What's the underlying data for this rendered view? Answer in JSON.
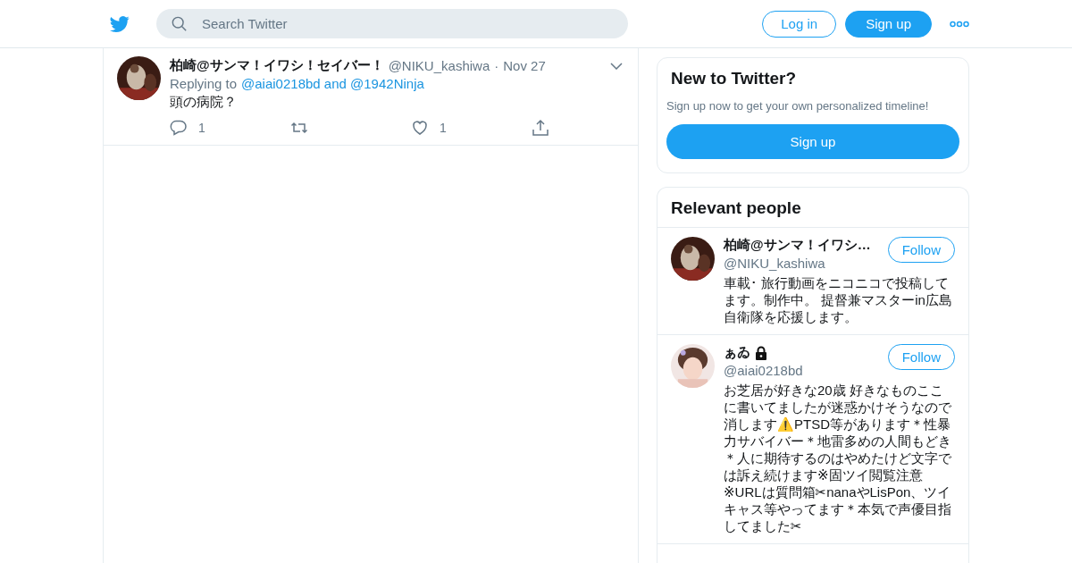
{
  "header": {
    "search": {
      "placeholder": "Search Twitter"
    },
    "buttons": [
      {
        "label": "Log in",
        "kind": "outline"
      },
      {
        "label": "Sign up",
        "kind": "filled"
      }
    ]
  },
  "tweet": {
    "name": "柏崎@サンマ！イワシ！セイバー！",
    "handle": "@NIKU_kashiwa",
    "separator": "·",
    "date": "Nov 27",
    "replying_label": "Replying to",
    "replying_to": "@aiai0218bd and @1942Ninja",
    "text": "頭の病院？",
    "actions": [
      {
        "kind": "reply",
        "count": "1"
      },
      {
        "kind": "retweet"
      },
      {
        "kind": "like",
        "count": "1"
      },
      {
        "kind": "share"
      }
    ]
  },
  "signup_card": {
    "title": "New to Twitter?",
    "subtitle": "Sign up now to get your own personalized timeline!",
    "button": "Sign up"
  },
  "relevant_people": {
    "title": "Relevant people",
    "people": [
      {
        "name": "柏崎@サンマ！イワシ…",
        "protected": false,
        "handle": "@NIKU_kashiwa",
        "follow": "Follow",
        "bio": "車載･ 旅行動画をニコニコで投稿してます。制作中。 提督兼マスターin広島自衛隊を応援します。"
      },
      {
        "name": "ぁゐ",
        "protected": true,
        "handle": "@aiai0218bd",
        "follow": "Follow",
        "bio": "お芝居が好きな20歳 好きなものここに書いてましたが迷惑かけそうなので消します⚠️PTSD等があります＊性暴力サバイバー＊地雷多めの人間もどき＊人に期待するのはやめたけど文字では訴え続けます※固ツイ閲覧注意※URLは質問箱✂nanaやLisPon、ツイキャス等やってます＊本気で声優目指してました✂"
      }
    ]
  }
}
